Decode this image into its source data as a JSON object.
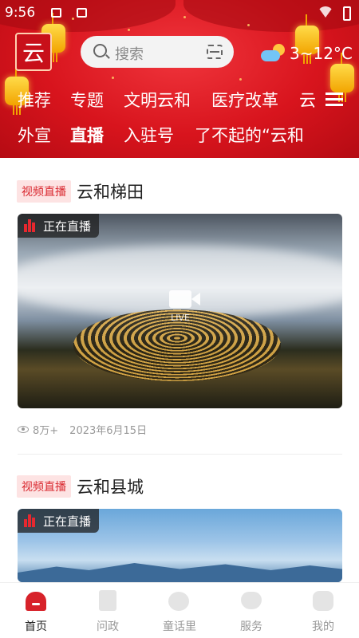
{
  "status_bar": {
    "time": "9:56"
  },
  "header": {
    "search_placeholder": "搜索",
    "weather": {
      "icon": "partly-cloudy-icon",
      "temp": "3~12°C"
    },
    "channels_row1": [
      "推荐",
      "专题",
      "文明云和",
      "医疗改革",
      "云"
    ],
    "channels_row2": [
      "外宣",
      "直播",
      "入驻号",
      "了不起的“云和"
    ],
    "active_channel": "直播"
  },
  "feed": [
    {
      "tag": "视频直播",
      "title": "云和梯田",
      "live_label": "正在直播",
      "play_label": "LIVE",
      "views": "8万+",
      "date": "2023年6月15日"
    },
    {
      "tag": "视频直播",
      "title": "云和县城",
      "live_label": "正在直播"
    }
  ],
  "tabbar": [
    {
      "label": "首页",
      "icon": "home-icon",
      "active": true
    },
    {
      "label": "问政",
      "icon": "document-icon",
      "active": false
    },
    {
      "label": "童话里",
      "icon": "bubble-icon",
      "active": false
    },
    {
      "label": "服务",
      "icon": "heart-icon",
      "active": false
    },
    {
      "label": "我的",
      "icon": "profile-icon",
      "active": false
    }
  ],
  "colors": {
    "brand_red": "#d8141d",
    "tag_bg": "#fde3e3",
    "tag_text": "#d9272e",
    "inactive_tab": "#999999"
  }
}
